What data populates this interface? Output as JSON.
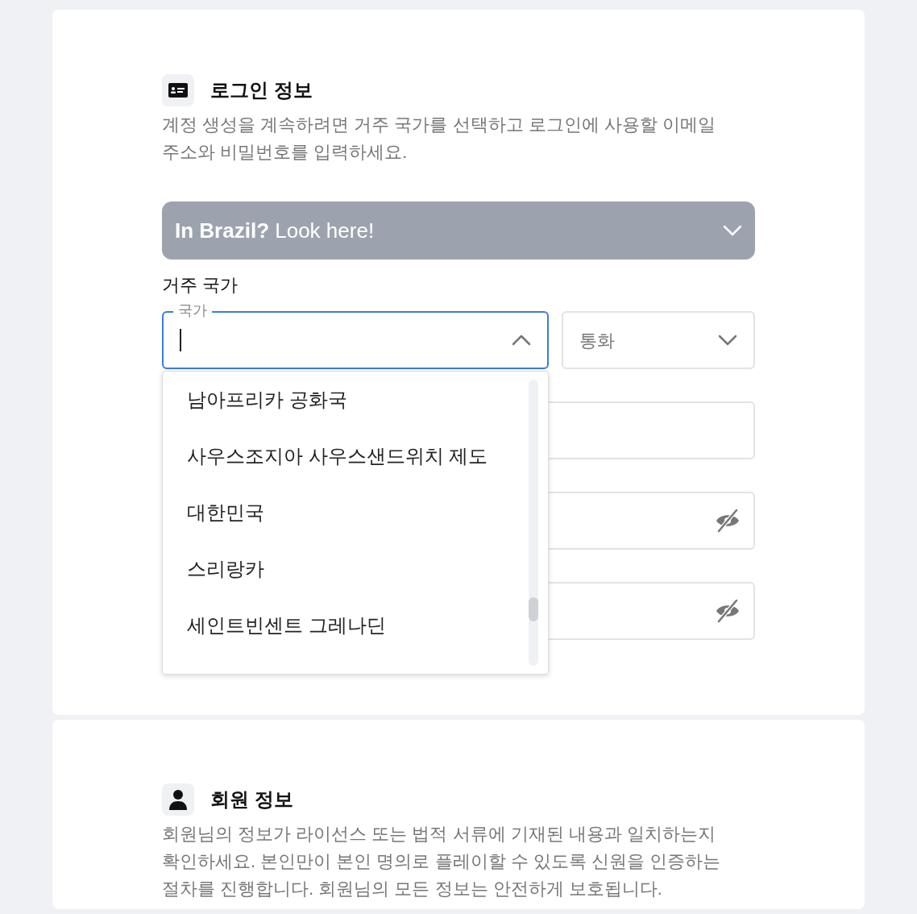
{
  "login_section": {
    "title": "로그인 정보",
    "description": "계정 생성을 계속하려면 거주 국가를 선택하고 로그인에 사용할 이메일 주소와 비밀번호를 입력하세요.",
    "banner": {
      "text": "**In Brazil?** Look here!",
      "expanded": false
    },
    "residence_label": "거주 국가",
    "country_field": {
      "label": "국가",
      "focused": true,
      "expanded": true,
      "options": [
        {
          "label": "남아프리카 공화국",
          "selected": false
        },
        {
          "label": "사우스조지아 사우스샌드위치 제도",
          "selected": false
        },
        {
          "label": "대한민국",
          "selected": false
        },
        {
          "label": "스리랑카",
          "selected": false
        },
        {
          "label": "세인트빈센트 그레나딘",
          "selected": false
        }
      ]
    },
    "currency_field": {
      "placeholder": "통화",
      "expanded": false
    },
    "fields": [
      {
        "kind": "text"
      },
      {
        "kind": "password"
      },
      {
        "kind": "password"
      }
    ]
  },
  "member_section": {
    "title": "회원 정보",
    "description": "회원님의 정보가 라이선스 또는 법적 서류에 기재된 내용과 일치하는지 확인하세요. 본인만이 본인 명의로 플레이할 수 있도록 신원을 인증하는 절차를 진행합니다. 회원님의 모든 정보는 안전하게 보호됩니다."
  }
}
